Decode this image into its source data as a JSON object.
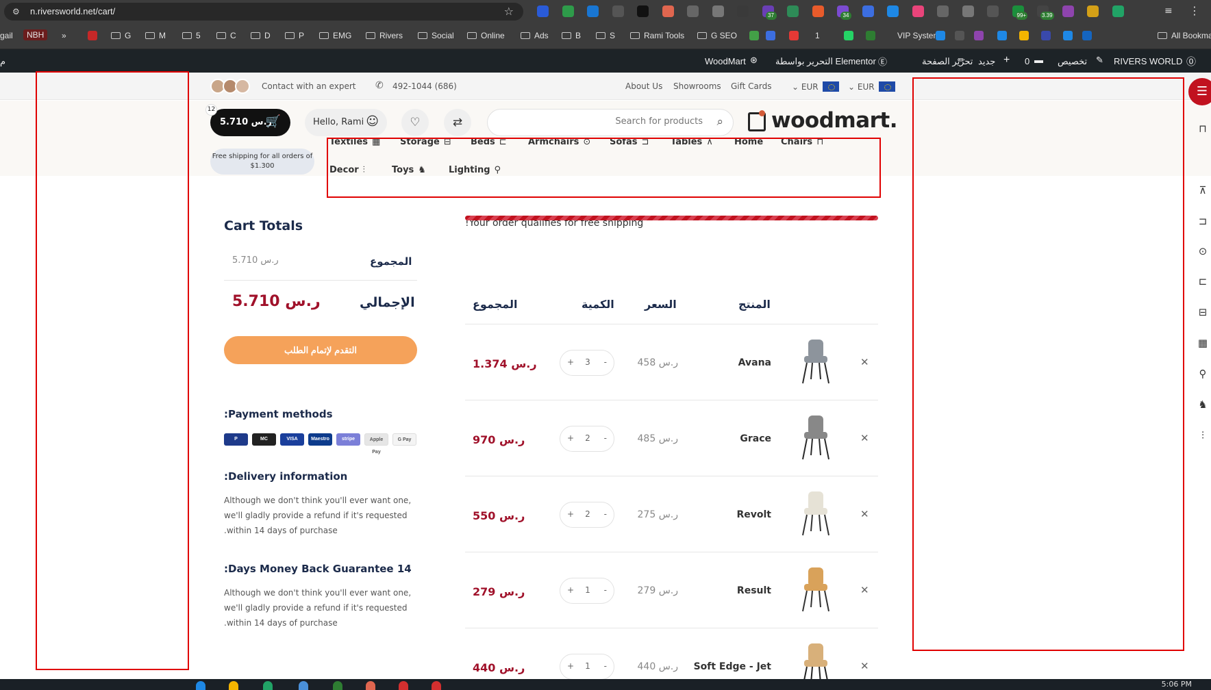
{
  "browser": {
    "url": "n.riversworld.net/cart/",
    "extensions": [
      {
        "name": "ext-1",
        "color": "#2a5bd7",
        "badge": ""
      },
      {
        "name": "ext-2",
        "color": "#2e9b4a",
        "badge": ""
      },
      {
        "name": "ext-3",
        "color": "#1976d2",
        "badge": ""
      },
      {
        "name": "ext-4",
        "color": "#555555",
        "badge": ""
      },
      {
        "name": "ext-5",
        "color": "#111111",
        "badge": ""
      },
      {
        "name": "ext-6",
        "color": "#e0664f",
        "badge": ""
      },
      {
        "name": "ext-7",
        "color": "#666666",
        "badge": ""
      },
      {
        "name": "ext-8",
        "color": "#777777",
        "badge": ""
      },
      {
        "name": "ext-9",
        "color": "#3a3a3a",
        "badge": ""
      },
      {
        "name": "ext-10",
        "color": "#6a3fb5",
        "badge": "37"
      },
      {
        "name": "ext-11",
        "color": "#2e8b57",
        "badge": ""
      },
      {
        "name": "ext-12",
        "color": "#e85b2b",
        "badge": ""
      },
      {
        "name": "ext-13",
        "color": "#7b4bd1",
        "badge": "34"
      },
      {
        "name": "ext-14",
        "color": "#3c6ee0",
        "badge": ""
      },
      {
        "name": "ext-15",
        "color": "#1e88e5",
        "badge": ""
      },
      {
        "name": "ext-16",
        "color": "#e9447a",
        "badge": ""
      },
      {
        "name": "ext-17",
        "color": "#666666",
        "badge": ""
      },
      {
        "name": "ext-18",
        "color": "#777777",
        "badge": ""
      },
      {
        "name": "ext-19",
        "color": "#555555",
        "badge": ""
      },
      {
        "name": "ext-20",
        "color": "#1b8f3c",
        "badge": "99+"
      },
      {
        "name": "ext-21",
        "color": "#444444",
        "badge": "3.39"
      },
      {
        "name": "ext-22",
        "color": "#8e44ad",
        "badge": ""
      },
      {
        "name": "ext-23",
        "color": "#d4a017",
        "badge": ""
      },
      {
        "name": "ext-24",
        "color": "#21a366",
        "badge": ""
      }
    ],
    "bookmarks": [
      {
        "label": "gail",
        "type": "text"
      },
      {
        "label": "NBH",
        "type": "badge"
      },
      {
        "label": "»",
        "type": "text"
      },
      {
        "label": "G",
        "type": "folder"
      },
      {
        "label": "M",
        "type": "folder"
      },
      {
        "label": "5",
        "type": "folder"
      },
      {
        "label": "C",
        "type": "folder"
      },
      {
        "label": "D",
        "type": "folder"
      },
      {
        "label": "P",
        "type": "folder"
      },
      {
        "label": "EMG",
        "type": "folder"
      },
      {
        "label": "Rivers",
        "type": "folder"
      },
      {
        "label": "Social",
        "type": "folder"
      },
      {
        "label": "Online",
        "type": "folder"
      },
      {
        "label": "Ads",
        "type": "folder"
      },
      {
        "label": "B",
        "type": "folder"
      },
      {
        "label": "S",
        "type": "folder"
      },
      {
        "label": "Rami Tools",
        "type": "folder"
      },
      {
        "label": "G SEO",
        "type": "folder"
      },
      {
        "label": "1",
        "type": "text"
      },
      {
        "label": "VIP System",
        "type": "text"
      },
      {
        "label": "All Bookmarks",
        "type": "folder"
      }
    ]
  },
  "adminbar": {
    "site": "RIVERS WORLD",
    "customize": "تخصيص",
    "comments": "0",
    "new": "جديد",
    "edit_page": "تحرير الصفحة",
    "elementor": "التحرير بواسطة Elementor",
    "woodmart": "WoodMart",
    "left_edge": "م"
  },
  "topbar": {
    "contact": "Contact with an expert",
    "phone": "492-1044 (686)",
    "links": [
      "About Us",
      "Showrooms",
      "Gift Cards"
    ],
    "currency1": "EUR",
    "currency2": "EUR"
  },
  "header": {
    "cart_amount": "5.710 ر.س",
    "cart_count": "12",
    "greeting": "Hello, Rami",
    "search_placeholder": "Search for products",
    "logo_text": "woodmart.",
    "free_shipping": "Free shipping for all orders of $1.300"
  },
  "nav": [
    {
      "label": "Textiles",
      "icon": "textiles-icon",
      "glyph": "▦"
    },
    {
      "label": "Storage",
      "icon": "storage-icon",
      "glyph": "⊟"
    },
    {
      "label": "Beds",
      "icon": "bed-icon",
      "glyph": "⊏"
    },
    {
      "label": "Armchairs",
      "icon": "armchair-icon",
      "glyph": "⊙"
    },
    {
      "label": "Sofas",
      "icon": "sofa-icon",
      "glyph": "⊐"
    },
    {
      "label": "Tables",
      "icon": "table-icon",
      "glyph": "⊼"
    },
    {
      "label": "Home",
      "icon": "",
      "glyph": ""
    },
    {
      "label": "Chairs",
      "icon": "chair-icon",
      "glyph": "⊓"
    },
    {
      "label": "Decor",
      "icon": "decor-icon",
      "glyph": "⫶"
    },
    {
      "label": "Toys",
      "icon": "toy-icon",
      "glyph": "♞"
    },
    {
      "label": "Lighting",
      "icon": "lamp-icon",
      "glyph": "⚲"
    }
  ],
  "totals": {
    "title": "Cart Totals",
    "subtotal_label": "المجموع",
    "subtotal_value": "5.710 ر.س",
    "total_label": "الإجمالي",
    "total_value": "5.710 ر.س",
    "checkout_label": "التقدم لإتمام الطلب",
    "payment_title": ":Payment methods",
    "payments": [
      {
        "label": "P",
        "color": "#1e3a8a"
      },
      {
        "label": "MC",
        "color": "#222222"
      },
      {
        "label": "VISA",
        "color": "#1a3f9c"
      },
      {
        "label": "Maestro",
        "color": "#0d3b8c"
      },
      {
        "label": "stripe",
        "color": "#7b7fd8"
      },
      {
        "label": "Apple Pay",
        "color": "#e6e6e6"
      },
      {
        "label": "G Pay",
        "color": "#f4f4f4"
      }
    ],
    "delivery_title": ":Delivery information",
    "delivery_text": "Although we don't think you'll ever want one, we'll gladly provide a refund if it's requested .within 14 days of purchase",
    "guarantee_title": ":Days Money Back Guarantee 14",
    "guarantee_text": "Although we don't think you'll ever want one, we'll gladly provide a refund if it's requested .within 14 days of purchase"
  },
  "cart": {
    "shipping_msg": "!Your order qualifies for free shipping",
    "shipping_progress": 1.0,
    "col_total": "المجموع",
    "col_qty": "الكمية",
    "col_price": "السعر",
    "col_product": "المنتج",
    "rows": [
      {
        "name": "Avana",
        "price": "458 ر.س",
        "qty": "3",
        "subtotal": "1.374 ر.س"
      },
      {
        "name": "Grace",
        "price": "485 ر.س",
        "qty": "2",
        "subtotal": "970 ر.س"
      },
      {
        "name": "Revolt",
        "price": "275 ر.س",
        "qty": "2",
        "subtotal": "550 ر.س"
      },
      {
        "name": "Result",
        "price": "279 ر.س",
        "qty": "1",
        "subtotal": "279 ر.س"
      },
      {
        "name": "Soft Edge - Jet",
        "price": "440 ر.س",
        "qty": "1",
        "subtotal": "440 ر.س"
      }
    ]
  },
  "taskbar": {
    "clock": "5:06 PM"
  }
}
